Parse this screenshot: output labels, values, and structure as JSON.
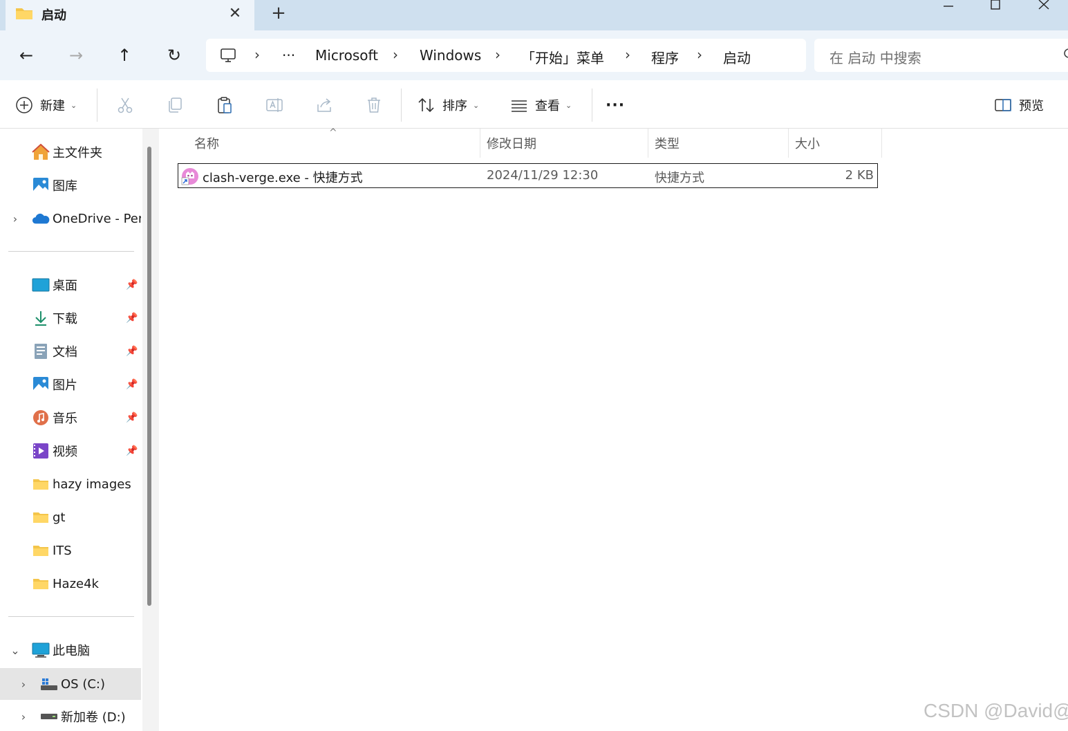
{
  "window": {
    "tab_title": "启动",
    "tab_close": "✕",
    "new_tab": "+",
    "minimize": "—",
    "maximize": "☐",
    "close": "✕"
  },
  "nav": {
    "back": "←",
    "forward": "→",
    "up": "↑",
    "refresh": "↻",
    "ellipsis": "···",
    "breadcrumbs": [
      "Microsoft",
      "Windows",
      "「开始」菜单",
      "程序",
      "启动"
    ],
    "separator": "›",
    "search_placeholder": "在 启动 中搜索"
  },
  "toolbar": {
    "new_label": "新建",
    "sort_label": "排序",
    "view_label": "查看",
    "more_label": "···",
    "preview_label": "预览"
  },
  "sidebar": {
    "quick": [
      {
        "label": "主文件夹",
        "icon": "home-icon"
      },
      {
        "label": "图库",
        "icon": "gallery-icon"
      },
      {
        "label": "OneDrive - Per",
        "icon": "onedrive-icon",
        "expandable": true
      }
    ],
    "pinned": [
      {
        "label": "桌面",
        "icon": "desktop-icon"
      },
      {
        "label": "下载",
        "icon": "download-icon"
      },
      {
        "label": "文档",
        "icon": "documents-icon"
      },
      {
        "label": "图片",
        "icon": "pictures-icon"
      },
      {
        "label": "音乐",
        "icon": "music-icon"
      },
      {
        "label": "视频",
        "icon": "videos-icon"
      }
    ],
    "folders": [
      "hazy images",
      "gt",
      "ITS",
      "Haze4k"
    ],
    "this_pc": "此电脑",
    "drives": [
      "OS (C:)",
      "新加卷 (D:)"
    ]
  },
  "columns": {
    "name": "名称",
    "date": "修改日期",
    "type": "类型",
    "size": "大小"
  },
  "files": [
    {
      "name": "clash-verge.exe - 快捷方式",
      "date": "2024/11/29 12:30",
      "type": "快捷方式",
      "size": "2 KB"
    }
  ],
  "watermark": "CSDN @David@"
}
